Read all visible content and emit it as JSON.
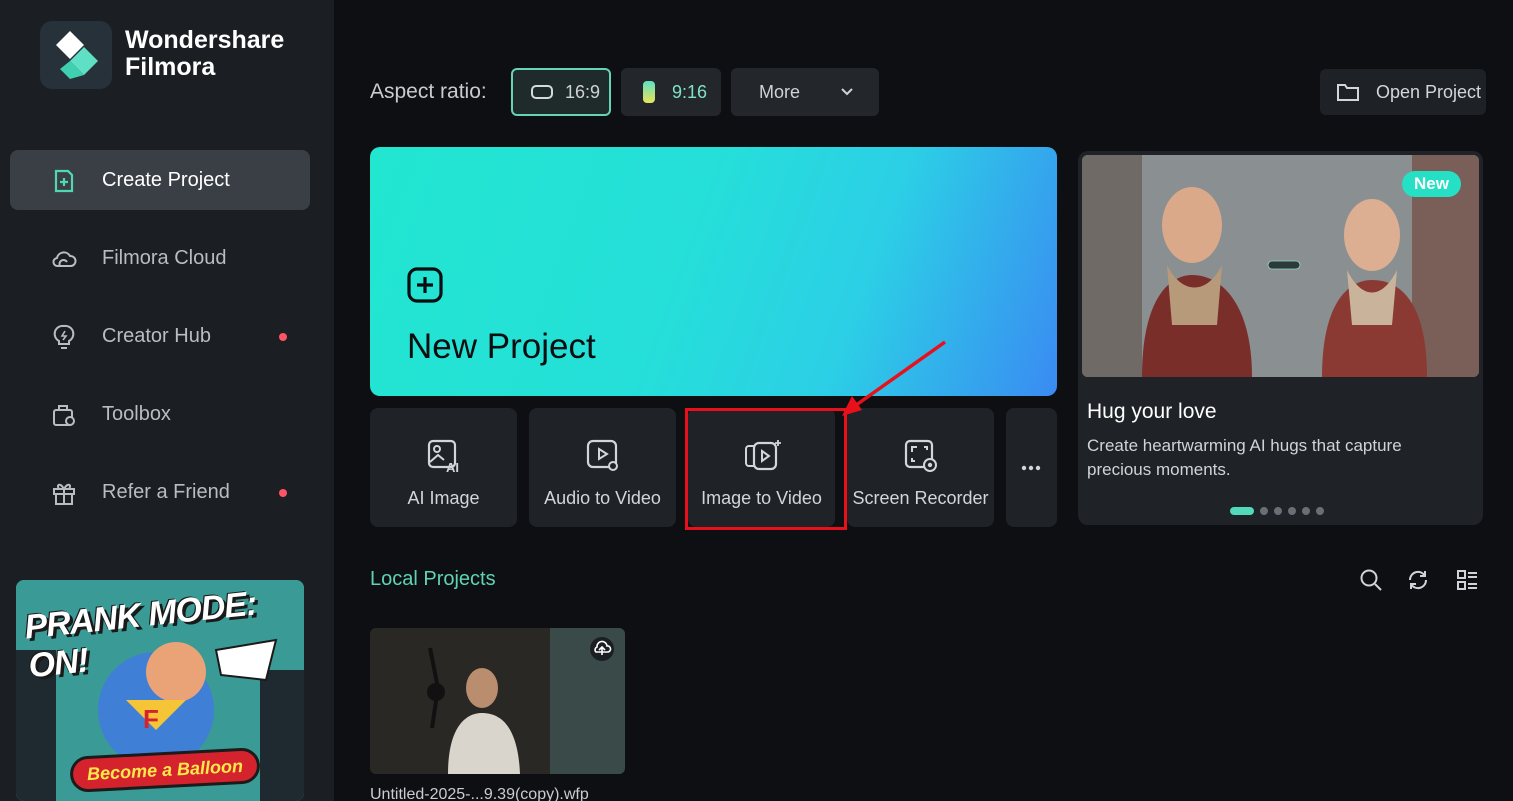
{
  "app": {
    "brand": "Wondershare\nFilmora"
  },
  "sidebar": {
    "items": [
      {
        "label": "Create Project",
        "active": true
      },
      {
        "label": "Filmora Cloud"
      },
      {
        "label": "Creator Hub",
        "dot": true
      },
      {
        "label": "Toolbox"
      },
      {
        "label": "Refer a Friend",
        "dot": true
      }
    ],
    "promo": {
      "title": "PRANK MODE: ON!",
      "cta": "Become a Balloon"
    }
  },
  "topbar": {
    "aspect_label": "Aspect ratio:",
    "ratio_16_9": "16:9",
    "ratio_9_16": "9:16",
    "more": "More",
    "open_project": "Open Project"
  },
  "new_project": {
    "title": "New Project"
  },
  "tools": [
    {
      "label": "AI Image",
      "icon": "ai-image-icon"
    },
    {
      "label": "Audio to Video",
      "icon": "audio-to-video-icon"
    },
    {
      "label": "Image to Video",
      "icon": "image-to-video-icon"
    },
    {
      "label": "Screen Recorder",
      "icon": "screen-recorder-icon"
    }
  ],
  "feature": {
    "badge": "New",
    "title": "Hug your love",
    "description": "Create heartwarming AI hugs that capture precious moments."
  },
  "local_projects": {
    "title": "Local Projects",
    "items": [
      {
        "name": "Untitled-2025-...9.39(copy).wfp"
      }
    ]
  },
  "colors": {
    "accent": "#5fd3b5",
    "highlight": "#e8101a",
    "dot": "#ff5468"
  }
}
